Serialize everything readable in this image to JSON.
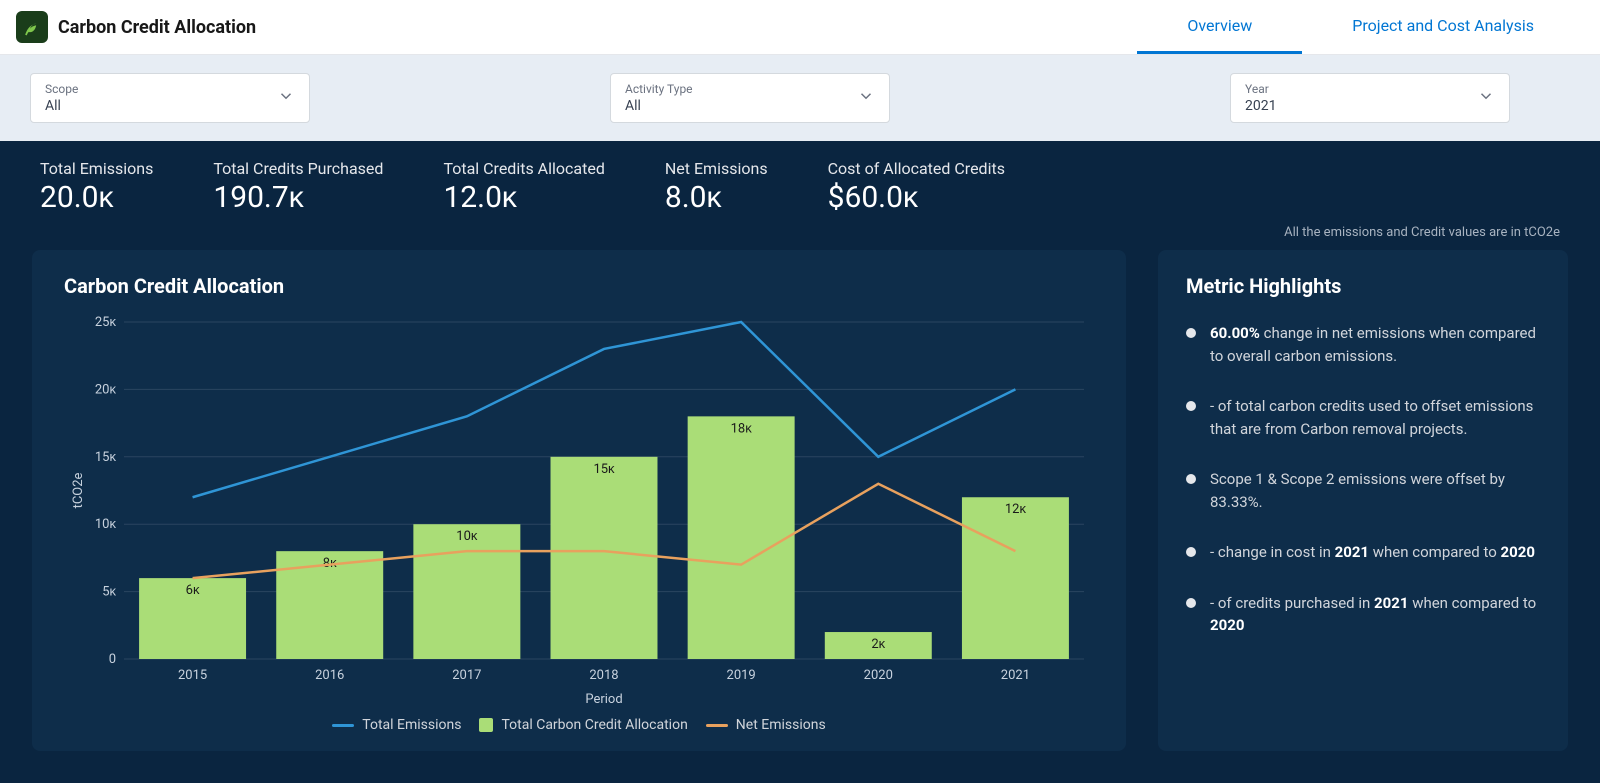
{
  "header": {
    "title": "Carbon Credit Allocation",
    "tabs": [
      {
        "label": "Overview",
        "active": true
      },
      {
        "label": "Project and Cost Analysis",
        "active": false
      }
    ]
  },
  "filters": {
    "scope": {
      "label": "Scope",
      "value": "All"
    },
    "activity": {
      "label": "Activity Type",
      "value": "All"
    },
    "year": {
      "label": "Year",
      "value": "2021"
    }
  },
  "kpis": {
    "total_emissions": {
      "label": "Total Emissions",
      "value": "20.0ᴋ"
    },
    "credits_purchased": {
      "label": "Total Credits Purchased",
      "value": "190.7ᴋ"
    },
    "credits_allocated": {
      "label": "Total Credits Allocated",
      "value": "12.0ᴋ"
    },
    "net_emissions": {
      "label": "Net Emissions",
      "value": "8.0ᴋ"
    },
    "cost_allocated": {
      "label": "Cost of Allocated Credits",
      "value": "$60.0ᴋ"
    }
  },
  "units_note": "All the emissions and Credit values are in tCO2e",
  "chart": {
    "title": "Carbon Credit Allocation",
    "x_title": "Period",
    "y_title": "tCO2e",
    "legend": {
      "total_emissions": "Total Emissions",
      "allocation": "Total Carbon Credit Allocation",
      "net_emissions": "Net Emissions"
    }
  },
  "highlights": {
    "title": "Metric Highlights",
    "items": [
      {
        "prefix": "",
        "bold1": "60.00%",
        "mid": " change in net emissions when compared to overall carbon emissions.",
        "bold2": "",
        "tail": ""
      },
      {
        "prefix": "-  of total carbon credits used to offset emissions that are from Carbon removal projects.",
        "bold1": "",
        "mid": "",
        "bold2": "",
        "tail": ""
      },
      {
        "prefix": "Scope 1 & Scope 2 emissions were offset by 83.33%.",
        "bold1": "",
        "mid": "",
        "bold2": "",
        "tail": ""
      },
      {
        "prefix": "-  change in cost in  ",
        "bold1": "2021",
        "mid": " when compared to ",
        "bold2": "2020",
        "tail": ""
      },
      {
        "prefix": "- of credits purchased in ",
        "bold1": "2021",
        "mid": " when compared to ",
        "bold2": "2020",
        "tail": ""
      }
    ]
  },
  "chart_data": {
    "type": "bar+line",
    "categories": [
      "2015",
      "2016",
      "2017",
      "2018",
      "2019",
      "2020",
      "2021"
    ],
    "series": [
      {
        "name": "Total Emissions",
        "type": "line",
        "color": "#2f95d6",
        "values": [
          12000,
          15000,
          18000,
          23000,
          25000,
          15000,
          20000
        ]
      },
      {
        "name": "Total Carbon Credit Allocation",
        "type": "bar",
        "color": "#aadd77",
        "values": [
          6000,
          8000,
          10000,
          15000,
          18000,
          2000,
          12000
        ],
        "labels": [
          "6ᴋ",
          "8ᴋ",
          "10ᴋ",
          "15ᴋ",
          "18ᴋ",
          "2ᴋ",
          "12ᴋ"
        ]
      },
      {
        "name": "Net Emissions",
        "type": "line",
        "color": "#e8a15e",
        "values": [
          6000,
          7000,
          8000,
          8000,
          7000,
          13000,
          8000
        ]
      }
    ],
    "xlabel": "Period",
    "ylabel": "tCO2e",
    "ylim": [
      0,
      25000
    ],
    "yticks": [
      0,
      5000,
      10000,
      15000,
      20000,
      25000
    ],
    "ytick_labels": [
      "0",
      "5ᴋ",
      "10ᴋ",
      "15ᴋ",
      "20ᴋ",
      "25ᴋ"
    ]
  }
}
